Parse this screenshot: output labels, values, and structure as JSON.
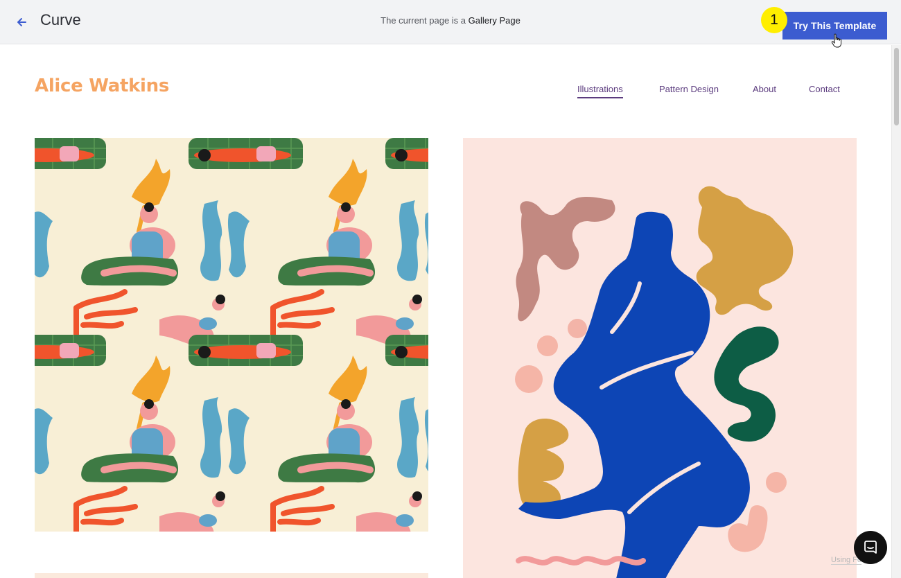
{
  "topbar": {
    "title": "Curve",
    "page_info_prefix": "The current page is a",
    "page_info_type": "Gallery Page",
    "cta_label": "Try This Template",
    "step_number": "1"
  },
  "site": {
    "brand": "Alice Watkins",
    "nav": [
      {
        "label": "Illustrations",
        "active": true
      },
      {
        "label": "Pattern Design",
        "active": false
      },
      {
        "label": "About",
        "active": false
      },
      {
        "label": "Contact",
        "active": false
      }
    ],
    "watermark": "Using Fo"
  },
  "icons": {
    "back": "arrow-left-icon",
    "chat": "chat-bubble-icon",
    "cursor": "hand-pointer-icon"
  },
  "colors": {
    "accent": "#3c5cd0",
    "brand": "#f5a462",
    "nav": "#5b3b7e",
    "badge": "#ffee00"
  }
}
